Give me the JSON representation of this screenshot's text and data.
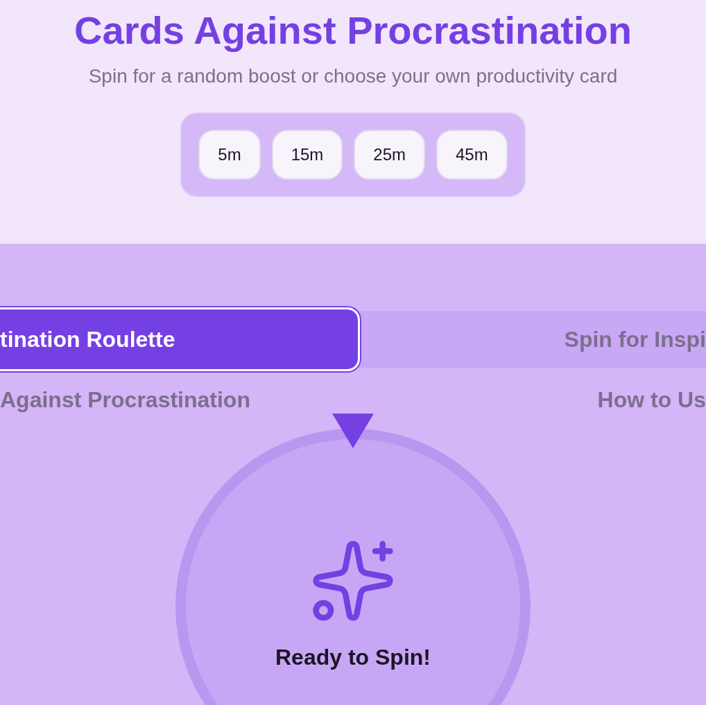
{
  "header": {
    "title": "Cards Against Procrastination",
    "subtitle": "Spin for a random boost or choose your own productivity card"
  },
  "durations": [
    {
      "label": "5m"
    },
    {
      "label": "15m"
    },
    {
      "label": "25m"
    },
    {
      "label": "45m"
    }
  ],
  "tabs": [
    {
      "label": "tination Roulette",
      "description": "Against Procrastination",
      "selected": true
    },
    {
      "label": "Spin for Inspi",
      "description": "How to Us",
      "selected": false
    }
  ],
  "wheel": {
    "status": "Ready to Spin!"
  }
}
